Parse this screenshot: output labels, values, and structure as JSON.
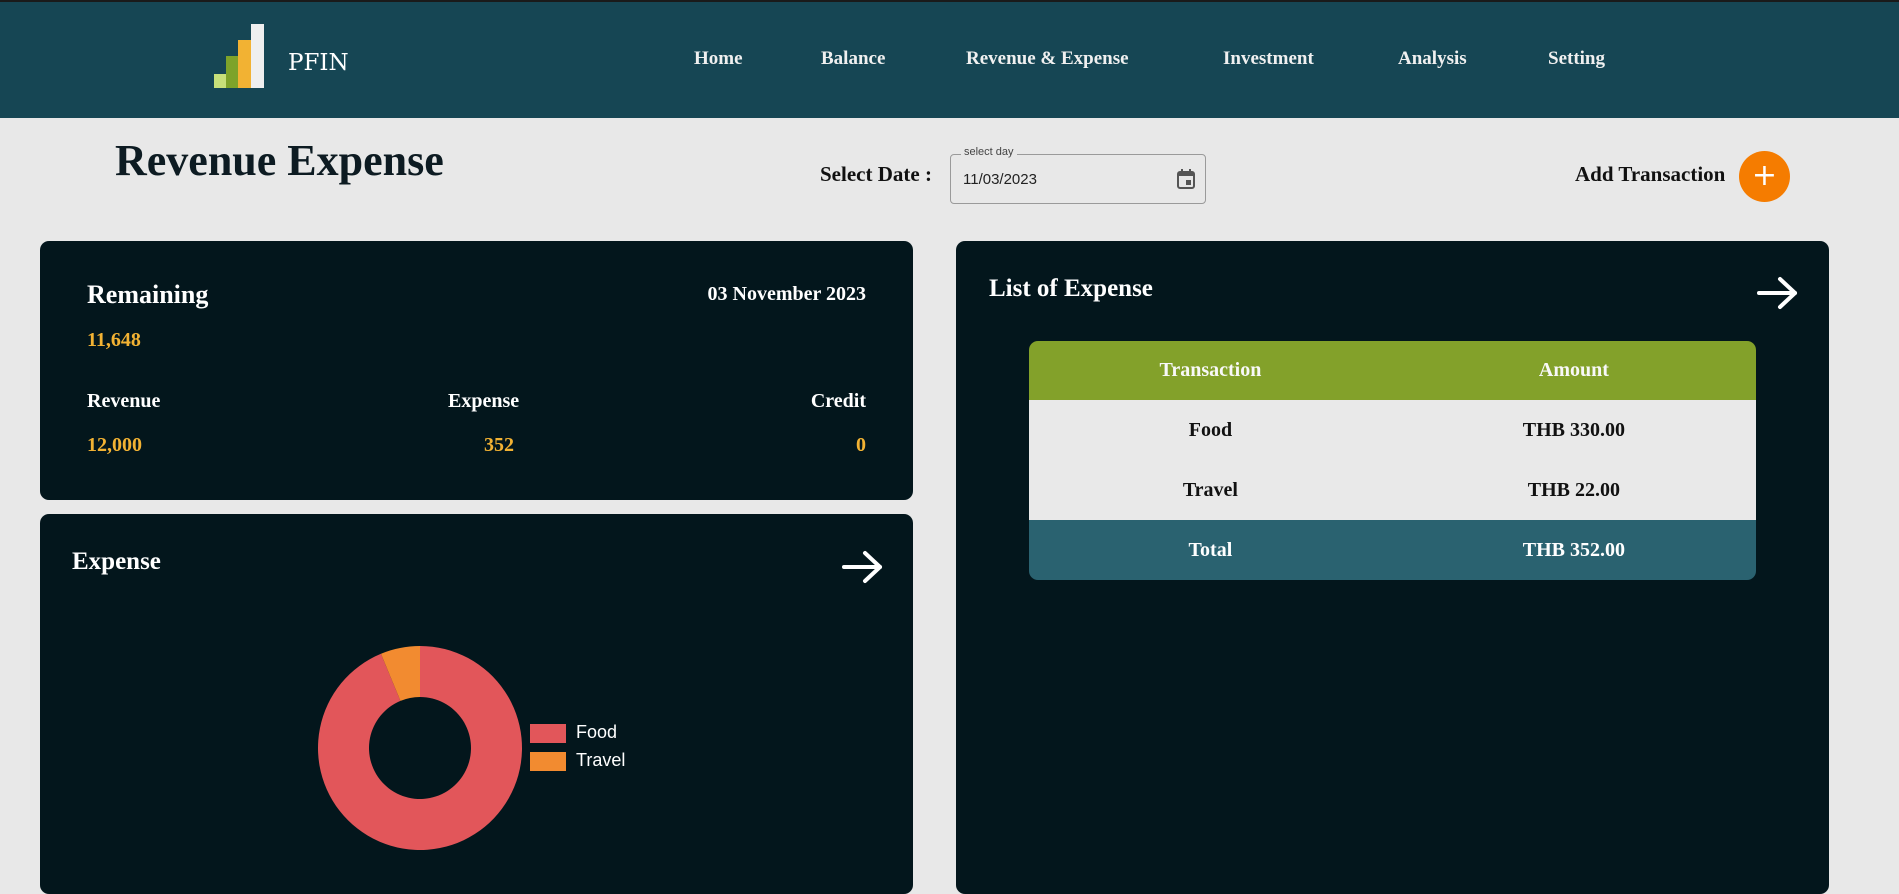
{
  "header": {
    "brand": "PFIN",
    "nav": [
      "Home",
      "Balance",
      "Revenue & Expense",
      "Investment",
      "Analysis",
      "Setting"
    ]
  },
  "page": {
    "title": "Revenue Expense",
    "select_date_label": "Select Date :",
    "date_field": {
      "legend": "select day",
      "value": "11/03/2023",
      "icon": "calendar-icon"
    },
    "add_transaction_label": "Add Transaction",
    "add_button_icon": "+"
  },
  "summary": {
    "remaining_label": "Remaining",
    "remaining_value": "11,648",
    "date": "03 November 2023",
    "revenue_label": "Revenue",
    "revenue_value": "12,000",
    "expense_label": "Expense",
    "expense_value": "352",
    "credit_label": "Credit",
    "credit_value": "0"
  },
  "expense_chart_card": {
    "title": "Expense",
    "arrow_icon": "arrow-right-icon"
  },
  "chart_data": {
    "type": "pie",
    "categories": [
      "Food",
      "Travel"
    ],
    "values": [
      330,
      22
    ],
    "colors": [
      "#e2565a",
      "#f28b30"
    ],
    "legend_position": "right",
    "donut": true
  },
  "list_card": {
    "title": "List of Expense",
    "arrow_icon": "arrow-right-icon",
    "columns": [
      "Transaction",
      "Amount"
    ],
    "rows": [
      {
        "transaction": "Food",
        "amount": "THB 330.00"
      },
      {
        "transaction": "Travel",
        "amount": "THB 22.00"
      }
    ],
    "total": {
      "label": "Total",
      "amount": "THB 352.00"
    }
  },
  "colors": {
    "header_bg": "#164654",
    "card_bg": "#03161c",
    "accent_orange": "#f57c00",
    "value_yellow": "#f2b233",
    "table_header": "#83a12a",
    "table_total": "#2a6270"
  }
}
